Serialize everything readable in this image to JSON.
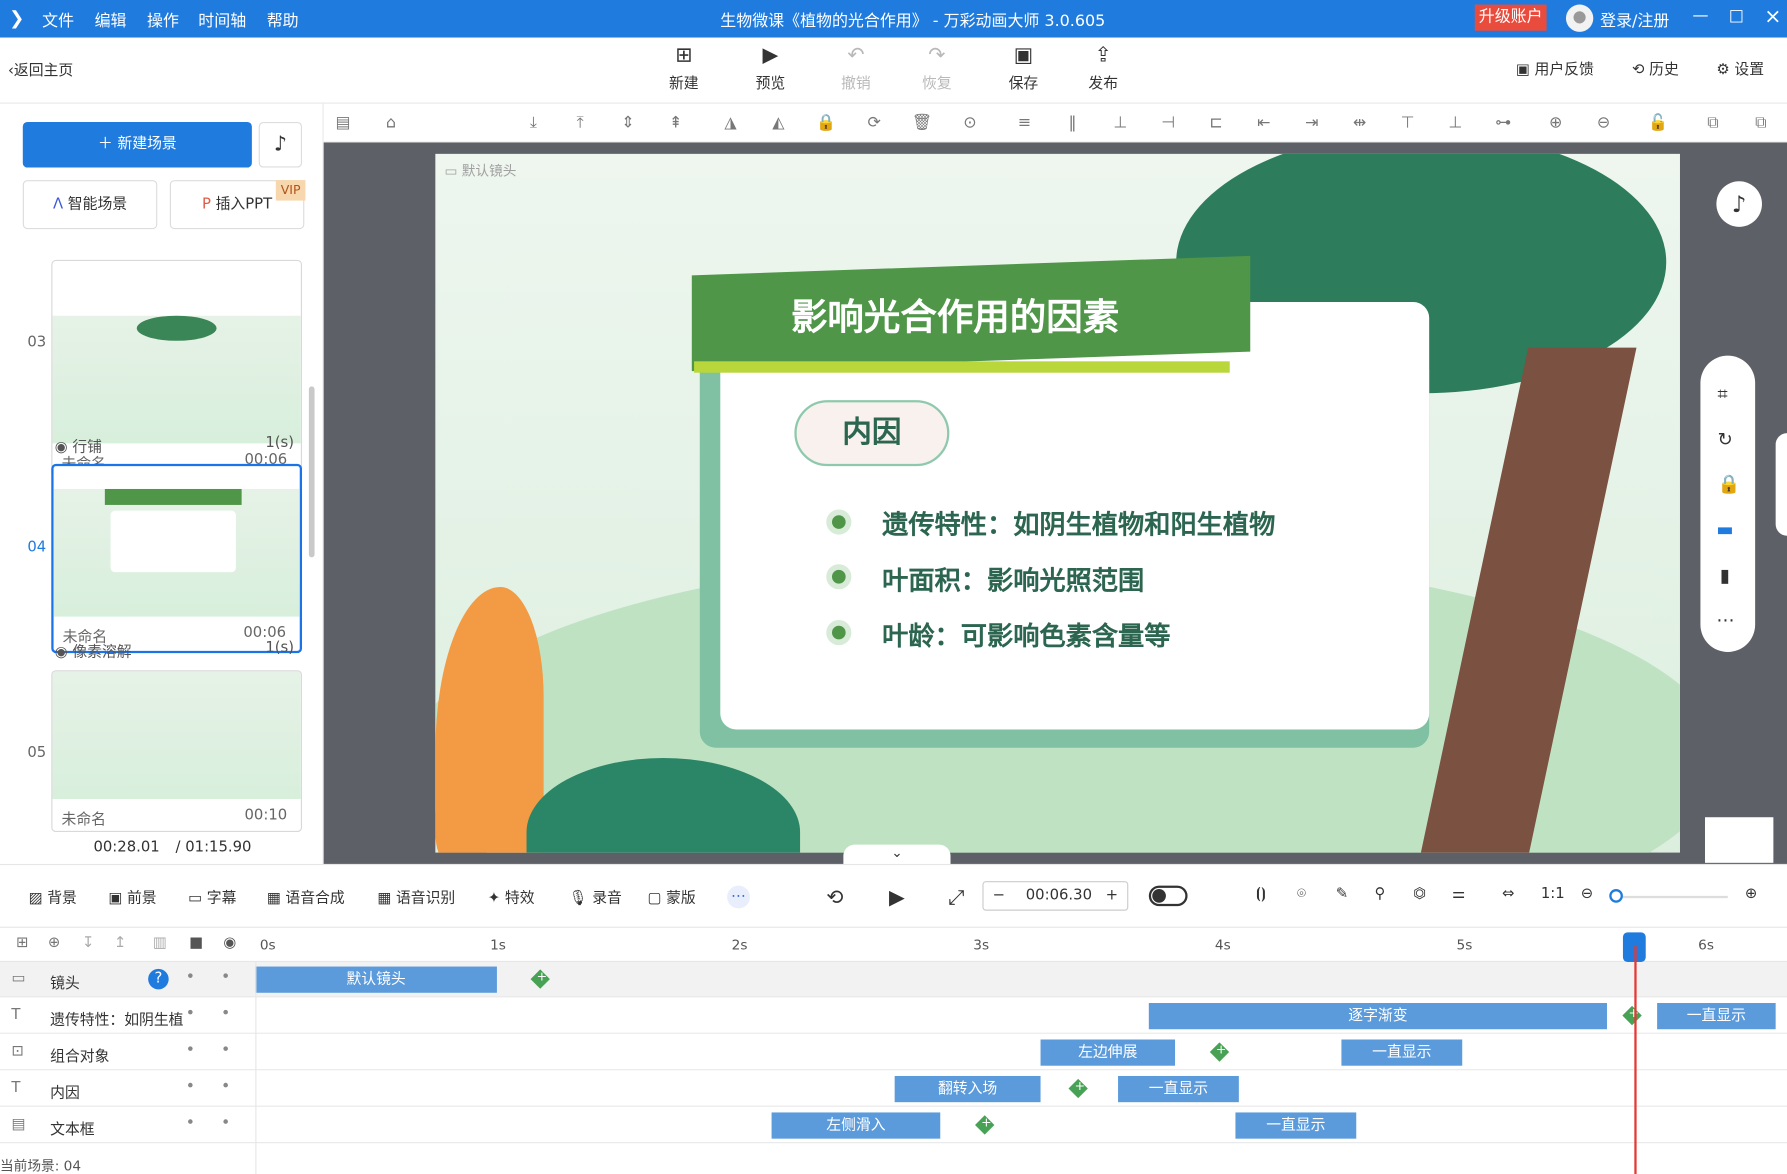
{
  "app": {
    "title": "生物微课《植物的光合作用》 - 万彩动画大师 3.0.605",
    "upgrade": "升级账户",
    "login": "登录/注册"
  },
  "menu": [
    "文件",
    "编辑",
    "操作",
    "时间轴",
    "帮助"
  ],
  "top": {
    "back": "返回主页",
    "buttons": [
      "新建",
      "预览",
      "撤销",
      "恢复",
      "保存",
      "发布"
    ],
    "links": [
      "用户反馈",
      "历史",
      "设置"
    ]
  },
  "sidebar": {
    "new_scene": "新建场景",
    "smart_scene": "智能场景",
    "insert_ppt": "插入PPT",
    "vip": "VIP",
    "scenes": [
      {
        "no": "03",
        "name": "未命名",
        "time": "00:06",
        "transition": "行铺",
        "trans_time": "1(s)"
      },
      {
        "no": "04",
        "name": "未命名",
        "time": "00:06",
        "transition": "像素溶解",
        "trans_time": "1(s)"
      },
      {
        "no": "05",
        "name": "未命名",
        "time": "00:10"
      }
    ],
    "current_time": "00:28.01",
    "total_time": "/ 01:15.90"
  },
  "canvas": {
    "camera_label": "默认镜头",
    "title": "影响光合作用的因素",
    "tag": "内因",
    "bullets": [
      "遗传特性：如阴生植物和阳生植物",
      "叶面积：影响光照范围",
      "叶龄：可影响色素含量等"
    ]
  },
  "bottom": {
    "tools": [
      "背景",
      "前景",
      "字幕",
      "语音合成",
      "语音识别",
      "特效",
      "录音",
      "蒙版"
    ],
    "time": "00:06.30"
  },
  "timeline": {
    "ruler": [
      "0s",
      "1s",
      "2s",
      "3s",
      "4s",
      "5s",
      "6s"
    ],
    "tracks": [
      {
        "name": "镜头"
      },
      {
        "name": "遗传特性：如阴生植"
      },
      {
        "name": "组合对象"
      },
      {
        "name": "内因"
      },
      {
        "name": "文本框"
      }
    ],
    "bars": {
      "camera": "默认镜头",
      "t1": "逐字渐变",
      "t1b": "一直显示",
      "t2": "左边伸展",
      "t2b": "一直显示",
      "t3": "翻转入场",
      "t3b": "一直显示",
      "t4": "左侧滑入",
      "t4b": "一直显示"
    },
    "current_scene": "当前场景: 04"
  },
  "colors": {
    "accent": "#1f7bde",
    "green": "#4f9648",
    "timeline_bar": "#5b9bdc"
  }
}
